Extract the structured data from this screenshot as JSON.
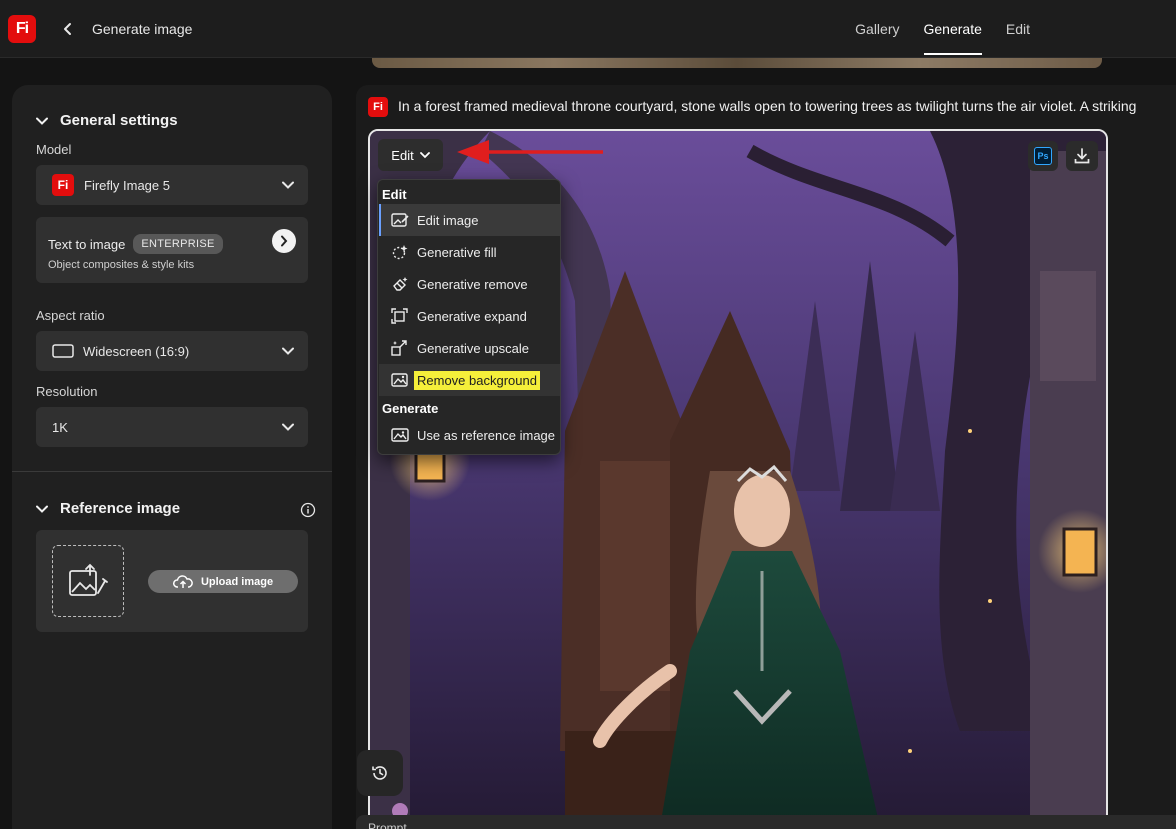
{
  "app": {
    "logo_text": "Fi",
    "page_title": "Generate image"
  },
  "nav": {
    "tabs": [
      {
        "label": "Gallery"
      },
      {
        "label": "Generate"
      },
      {
        "label": "Edit"
      }
    ],
    "active_tab": "Generate"
  },
  "sidebar": {
    "general_settings": {
      "title": "General settings",
      "model_label": "Model",
      "model_value": "Firefly Image 5",
      "mode_title": "Text to image",
      "mode_badge": "ENTERPRISE",
      "mode_subtitle": "Object composites & style kits",
      "aspect_label": "Aspect ratio",
      "aspect_value": "Widescreen (16:9)",
      "resolution_label": "Resolution",
      "resolution_value": "1K"
    },
    "reference_image": {
      "title": "Reference image",
      "upload_label": "Upload image"
    }
  },
  "main": {
    "prompt": "In a forest framed medieval throne courtyard, stone walls open to towering trees as twilight turns the air violet. A striking",
    "edit_button_label": "Edit",
    "menu": {
      "edit_group": "Edit",
      "edit_items": [
        {
          "label": "Edit image",
          "icon": "edit-image-icon"
        },
        {
          "label": "Generative fill",
          "icon": "generative-fill-icon"
        },
        {
          "label": "Generative remove",
          "icon": "generative-remove-icon"
        },
        {
          "label": "Generative expand",
          "icon": "generative-expand-icon"
        },
        {
          "label": "Generative upscale",
          "icon": "generative-upscale-icon"
        },
        {
          "label": "Remove background",
          "icon": "remove-background-icon"
        }
      ],
      "generate_group": "Generate",
      "generate_items": [
        {
          "label": "Use as reference image",
          "icon": "reference-image-icon"
        }
      ]
    },
    "ps_label": "Ps",
    "bottom_text": "Prompt"
  },
  "colors": {
    "brand": "#e30d0d",
    "highlight": "#f5ef3a",
    "arrow": "#e01e1e",
    "accent_selected": "#6aa0ff"
  }
}
